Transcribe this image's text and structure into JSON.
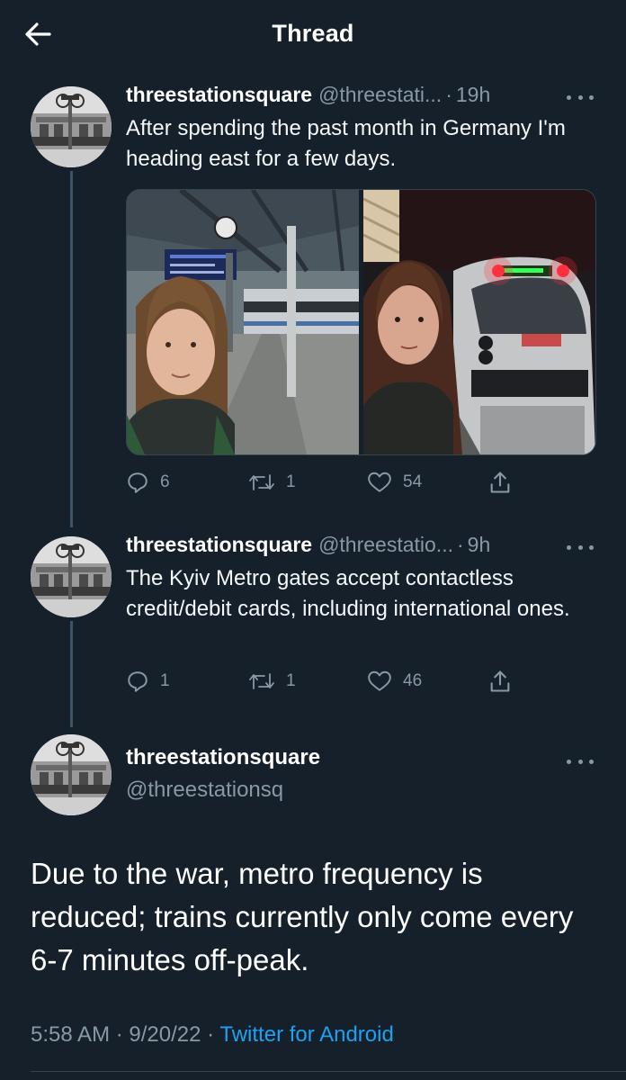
{
  "header": {
    "title": "Thread"
  },
  "colors": {
    "background": "#15202b",
    "secondary_text": "#8899a6",
    "link": "#1da1f2",
    "thread_line": "#3d5466"
  },
  "tweets": [
    {
      "name": "threestationsquare",
      "handle": "@threestati...",
      "time": "19h",
      "text": "After spending the past month in Germany I'm heading east for a few days.",
      "media": [
        "selfie on train platform",
        "selfie with red-lit train"
      ],
      "replies": "6",
      "retweets": "1",
      "likes": "54"
    },
    {
      "name": "threestationsquare",
      "handle": "@threestatio...",
      "time": "9h",
      "text": "The Kyiv Metro gates accept contactless credit/debit cards, including international ones.",
      "replies": "1",
      "retweets": "1",
      "likes": "46"
    }
  ],
  "main_tweet": {
    "name": "threestationsquare",
    "handle": "@threestationsq",
    "text": "Due to the war, metro frequency is reduced; trains currently only come every 6-7 minutes off-peak.",
    "time": "5:58 AM",
    "date": "9/20/22",
    "source": "Twitter for Android"
  },
  "separators": {
    "dot": "·"
  },
  "icons": [
    "back-arrow-icon",
    "more-icon",
    "reply-icon",
    "retweet-icon",
    "like-icon",
    "share-icon"
  ]
}
